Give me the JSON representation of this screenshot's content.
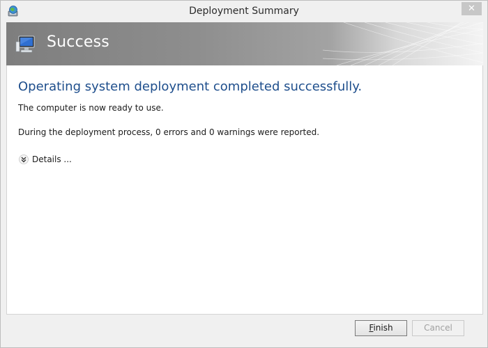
{
  "window": {
    "title": "Deployment Summary",
    "close_glyph": "✕",
    "app_icon": "deployment-globe-icon"
  },
  "banner": {
    "title": "Success",
    "icon": "computer-monitor-icon"
  },
  "main": {
    "heading": "Operating system deployment completed successfully.",
    "ready_text": "The computer is now ready to use.",
    "report_text": "During the deployment process, 0 errors and 0 warnings were reported.",
    "details_label": "Details ...",
    "details_icon": "double-chevron-down-icon"
  },
  "buttons": {
    "finish_access_key": "F",
    "finish_rest": "inish",
    "cancel_label": "Cancel"
  },
  "colors": {
    "heading": "#1e4e8c",
    "banner_dark": "#7e7e7e",
    "banner_light": "#f4f4f4"
  }
}
